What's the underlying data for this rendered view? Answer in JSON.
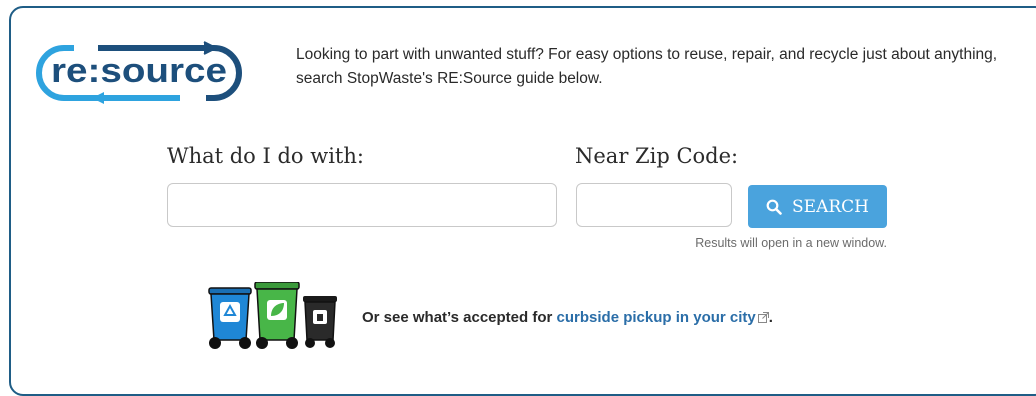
{
  "logo": {
    "text": "re:source"
  },
  "intro": {
    "text": "Looking to part with unwanted stuff? For easy options to reuse, repair, and recycle just about anything, search StopWaste's RE:Source guide below."
  },
  "search": {
    "what_label": "What do I do with:",
    "what_value": "",
    "zip_label": "Near Zip Code:",
    "zip_value": "",
    "button_label": "SEARCH",
    "note": "Results will open in a new window."
  },
  "curbside": {
    "prefix": "Or see what’s accepted for ",
    "link_text": "curbside pickup in your city",
    "suffix": "."
  },
  "colors": {
    "border": "#1f5d86",
    "logo_dark": "#1d4f7c",
    "logo_light": "#2ea3df",
    "button": "#4aa3dd",
    "link": "#2b6ea8",
    "bin_blue": "#1f87d6",
    "bin_green": "#48b648",
    "bin_black": "#2a2a2a"
  },
  "icons": [
    "resource-logo",
    "search-icon",
    "recycle-bin-icon",
    "compost-bin-icon",
    "trash-bin-icon",
    "external-link-icon"
  ]
}
